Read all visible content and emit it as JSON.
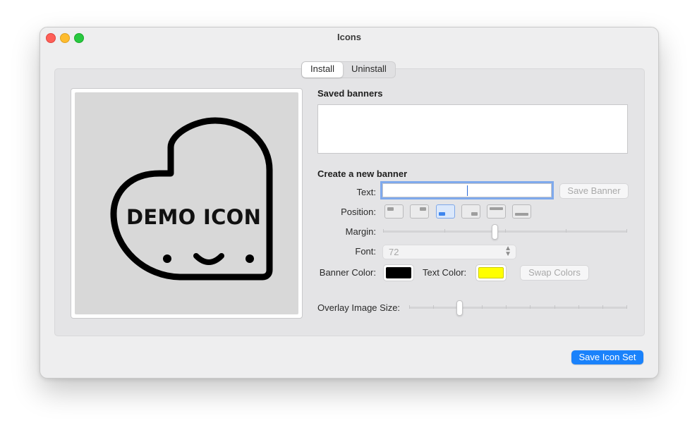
{
  "window": {
    "title": "Icons"
  },
  "tabs": [
    {
      "label": "Install",
      "selected": true
    },
    {
      "label": "Uninstall",
      "selected": false
    }
  ],
  "preview": {
    "icon_text": "DEMO ICON",
    "icon_name": "heart-face-icon"
  },
  "saved_banners": {
    "title": "Saved banners",
    "items": []
  },
  "create_banner": {
    "title": "Create a new banner",
    "text_label": "Text:",
    "text_value": "",
    "save_banner_button": "Save Banner",
    "position_label": "Position:",
    "position_options": [
      "top-left",
      "top-right",
      "bottom-left",
      "bottom-right",
      "top",
      "bottom"
    ],
    "position_selected": "bottom-left",
    "margin_label": "Margin:",
    "margin_value": 0.5,
    "font_label": "Font:",
    "font_value": "72",
    "banner_color_label": "Banner Color:",
    "banner_color": "#000000",
    "text_color_label": "Text Color:",
    "text_color": "#ffff00",
    "swap_colors_button": "Swap Colors"
  },
  "overlay": {
    "label": "Overlay Image Size:",
    "value": 0.23
  },
  "save_icon_set_button": "Save Icon Set",
  "accent_color": "#1a82fb"
}
